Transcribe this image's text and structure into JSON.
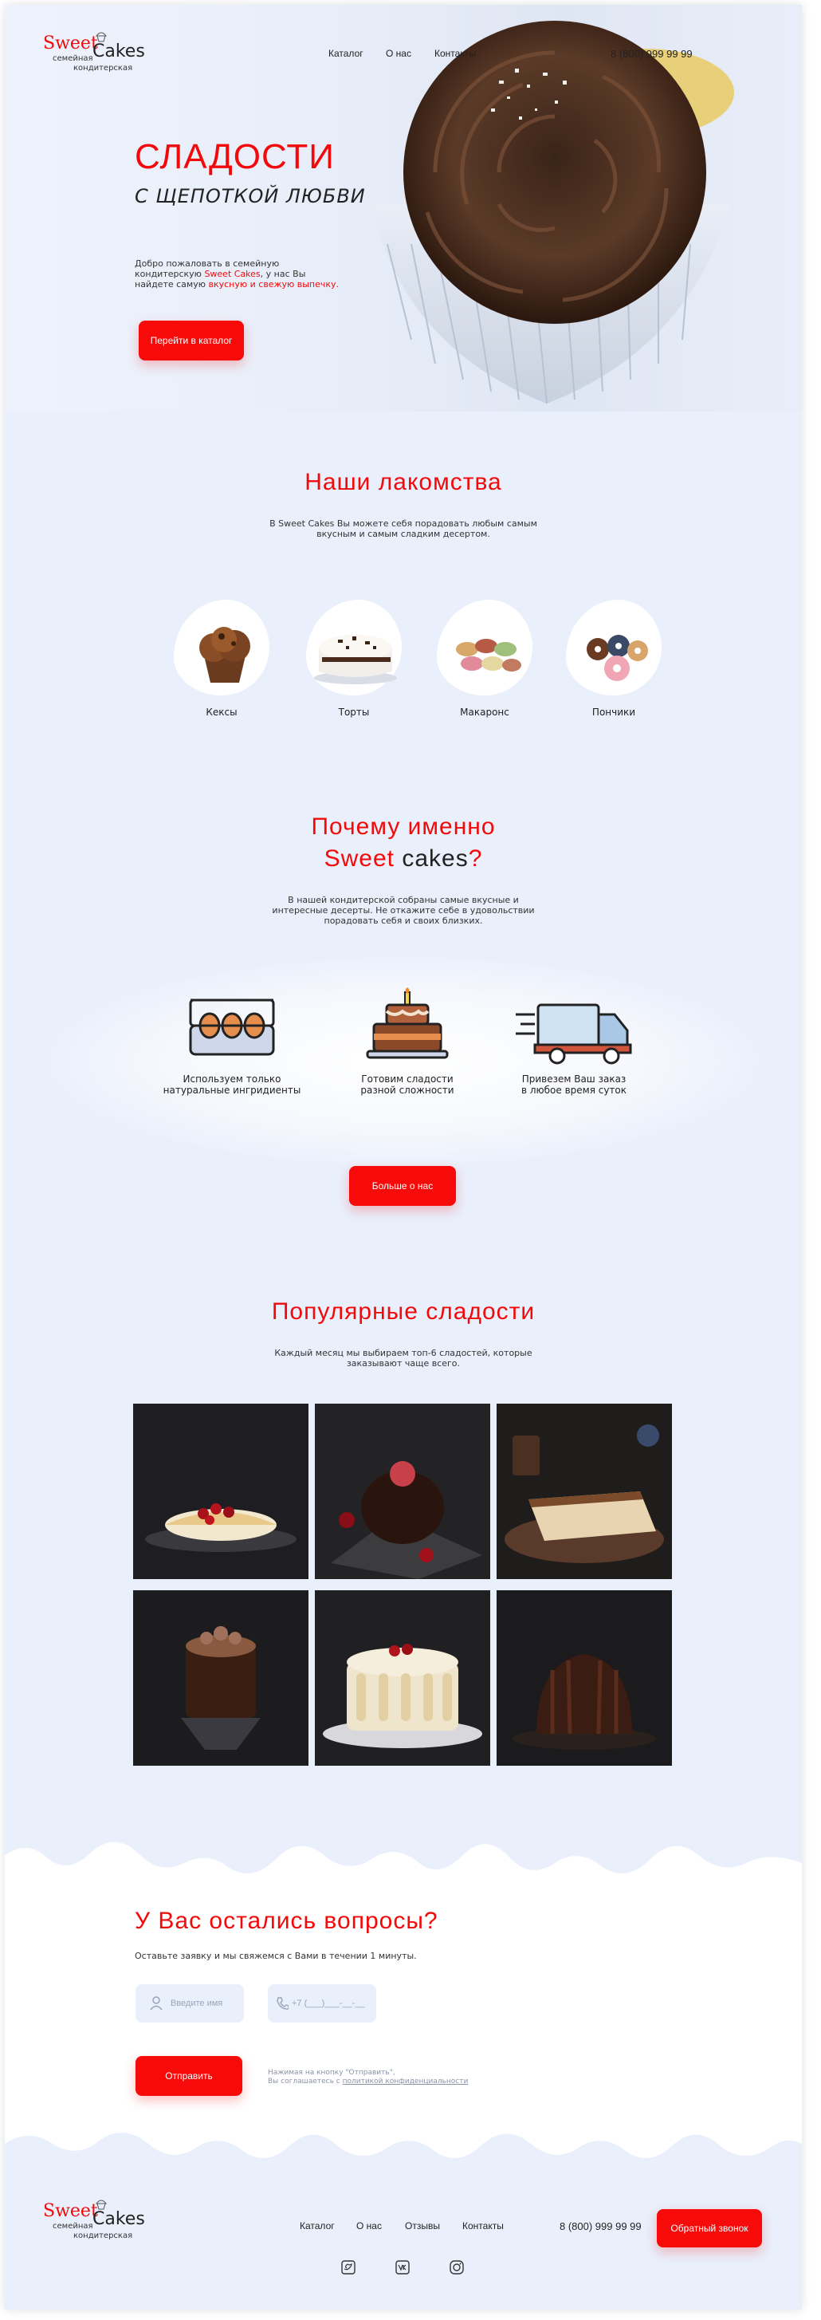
{
  "logo": {
    "sweet": "Sweet",
    "cakes": "Cakes",
    "sub1": "семейная",
    "sub2": "кондитерская"
  },
  "nav": {
    "catalog": "Каталог",
    "about": "О нас",
    "contacts": "Контакты"
  },
  "phone": "8 (800) 999 99 99",
  "hero": {
    "title": "СЛАДОСТИ",
    "subtitle": "С ЩЕПОТКОЙ ЛЮБВИ",
    "text_1": "Добро пожаловать в семейную",
    "text_2a": "кондитерскую ",
    "text_2b": "Sweet Cakes",
    "text_2c": ", у нас Вы",
    "text_3a": "найдете самую ",
    "text_3b": "вкусную и свежую выпечку.",
    "button": "Перейти в каталог"
  },
  "treats": {
    "title": "Наши лакомства",
    "desc_1": "В Sweet Cakes Вы можете себя порадовать любым самым",
    "desc_2": "вкусным и самым сладким десертом.",
    "items": [
      {
        "label": "Кексы",
        "icon": "muffin-icon"
      },
      {
        "label": "Торты",
        "icon": "cake-icon"
      },
      {
        "label": "Макаронс",
        "icon": "macarons-icon"
      },
      {
        "label": "Пончики",
        "icon": "donuts-icon"
      }
    ]
  },
  "why": {
    "title_1": "Почему именно",
    "title_2a": "Sweet",
    "title_2b": " cakes",
    "title_2c": "?",
    "desc_1": "В нашей кондитерской собраны самые вкусные и",
    "desc_2": "интересные десерты. Не откажите себе в удовольствии",
    "desc_3": "порадовать себя и своих близких.",
    "items": [
      {
        "line1": "Используем только",
        "line2": "натуральные ингридиенты",
        "icon": "eggs-icon"
      },
      {
        "line1": "Готовим сладости",
        "line2": "разной сложности",
        "icon": "birthday-cake-icon"
      },
      {
        "line1": "Привезем Ваш заказ",
        "line2": "в любое время суток",
        "icon": "delivery-truck-icon"
      }
    ],
    "button": "Больше о нас"
  },
  "popular": {
    "title": "Популярные сладости",
    "desc_1": "Каждый месяц мы выбираем топ-6 сладостей, которые",
    "desc_2": "заказывают чаще всего."
  },
  "questions": {
    "title": "У Вас остались вопросы?",
    "desc": "Оставьте заявку и мы свяжемся с Вами в течении 1 минуты.",
    "name_placeholder": "Введите имя",
    "phone_placeholder": "+7 (___)___-__-__",
    "submit": "Отправить",
    "consent_1": "Нажимая на кнопку \"Отправить\",",
    "consent_2": "Вы соглашаетесь с ",
    "consent_link": "политикой конфиденциальности"
  },
  "footer": {
    "nav": {
      "catalog": "Каталог",
      "about": "О нас",
      "reviews": "Отзывы",
      "contacts": "Контакты"
    },
    "phone": "8 (800) 999 99 99",
    "callback": "Обратный звонок",
    "social": [
      "twitter-icon",
      "vk-icon",
      "instagram-icon"
    ]
  },
  "colors": {
    "accent": "#f20a0a",
    "background": "#e9effb",
    "text": "#222222"
  }
}
